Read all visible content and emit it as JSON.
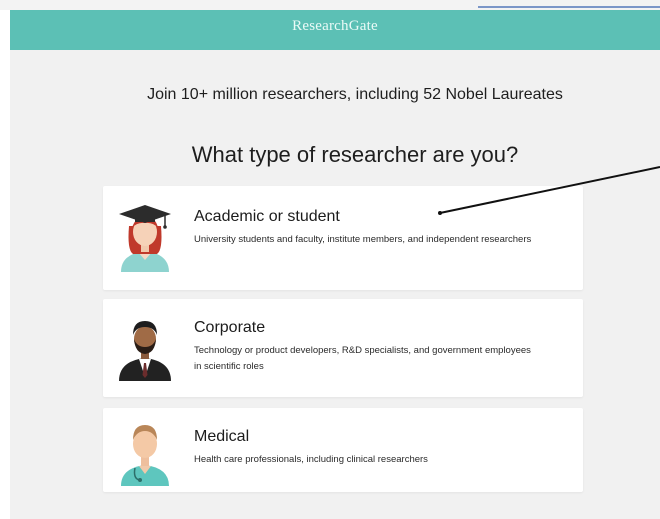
{
  "header": {
    "brand": "ResearchGate"
  },
  "main": {
    "tagline": "Join 10+ million researchers, including 52 Nobel Laureates",
    "question": "What type of researcher are you?"
  },
  "options": [
    {
      "title": "Academic or student",
      "description": "University students and faculty, institute members, and independent researchers",
      "icon": "academic-avatar-icon"
    },
    {
      "title": "Corporate",
      "description": "Technology or product developers, R&D specialists, and government employees in scientific roles",
      "icon": "corporate-avatar-icon"
    },
    {
      "title": "Medical",
      "description": "Health care professionals, including clinical researchers",
      "icon": "medical-avatar-icon"
    }
  ],
  "colors": {
    "header": "#5cc0b5",
    "background": "#f1f1f1",
    "card": "#ffffff",
    "annotation": "#111111"
  }
}
